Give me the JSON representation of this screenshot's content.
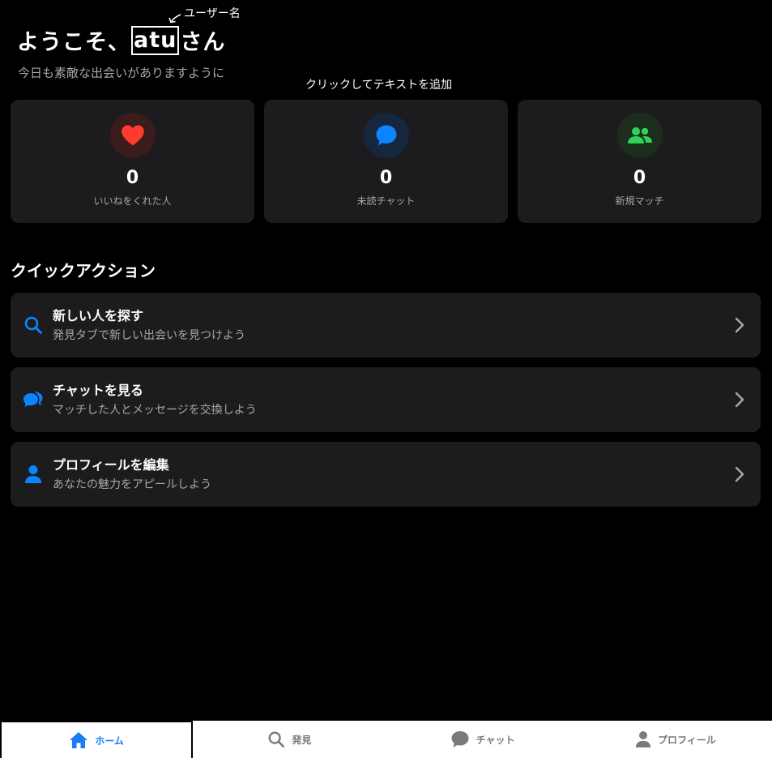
{
  "annotation": {
    "label": "ユーザー名"
  },
  "header": {
    "greeting_prefix": "ようこそ、",
    "username": "atu",
    "greeting_suffix": "さん",
    "subtitle": "今日も素敵な出会いがありますように"
  },
  "hint": {
    "add_text": "クリックしてテキストを追加"
  },
  "stats": [
    {
      "value": "0",
      "label": "いいねをくれた人",
      "icon": "heart-icon",
      "color": "#ff3b30",
      "bg": "#3a1c1c"
    },
    {
      "value": "0",
      "label": "未読チャット",
      "icon": "chat-bubble-icon",
      "color": "#0a84ff",
      "bg": "#16263c"
    },
    {
      "value": "0",
      "label": "新規マッチ",
      "icon": "people-icon",
      "color": "#30d158",
      "bg": "#1b2e1e"
    }
  ],
  "quick_actions": {
    "title": "クイックアクション",
    "items": [
      {
        "title": "新しい人を探す",
        "desc": "発見タブで新しい出会いを見つけよう",
        "icon": "search-icon"
      },
      {
        "title": "チャットを見る",
        "desc": "マッチした人とメッセージを交換しよう",
        "icon": "chat-bubbles-icon"
      },
      {
        "title": "プロフィールを編集",
        "desc": "あなたの魅力をアピールしよう",
        "icon": "person-icon"
      }
    ]
  },
  "tabbar": {
    "tabs": [
      {
        "label": "ホーム",
        "icon": "home-icon",
        "active": true
      },
      {
        "label": "発見",
        "icon": "search-icon",
        "active": false
      },
      {
        "label": "チャット",
        "icon": "chat-bubble-icon",
        "active": false
      },
      {
        "label": "プロフィール",
        "icon": "person-icon",
        "active": false
      }
    ],
    "active_color": "#1a7df5",
    "inactive_color": "#7a7a7a"
  },
  "colors": {
    "accent": "#0a84ff",
    "card_bg": "#1c1c1e",
    "muted_text": "#a8a8a8"
  }
}
